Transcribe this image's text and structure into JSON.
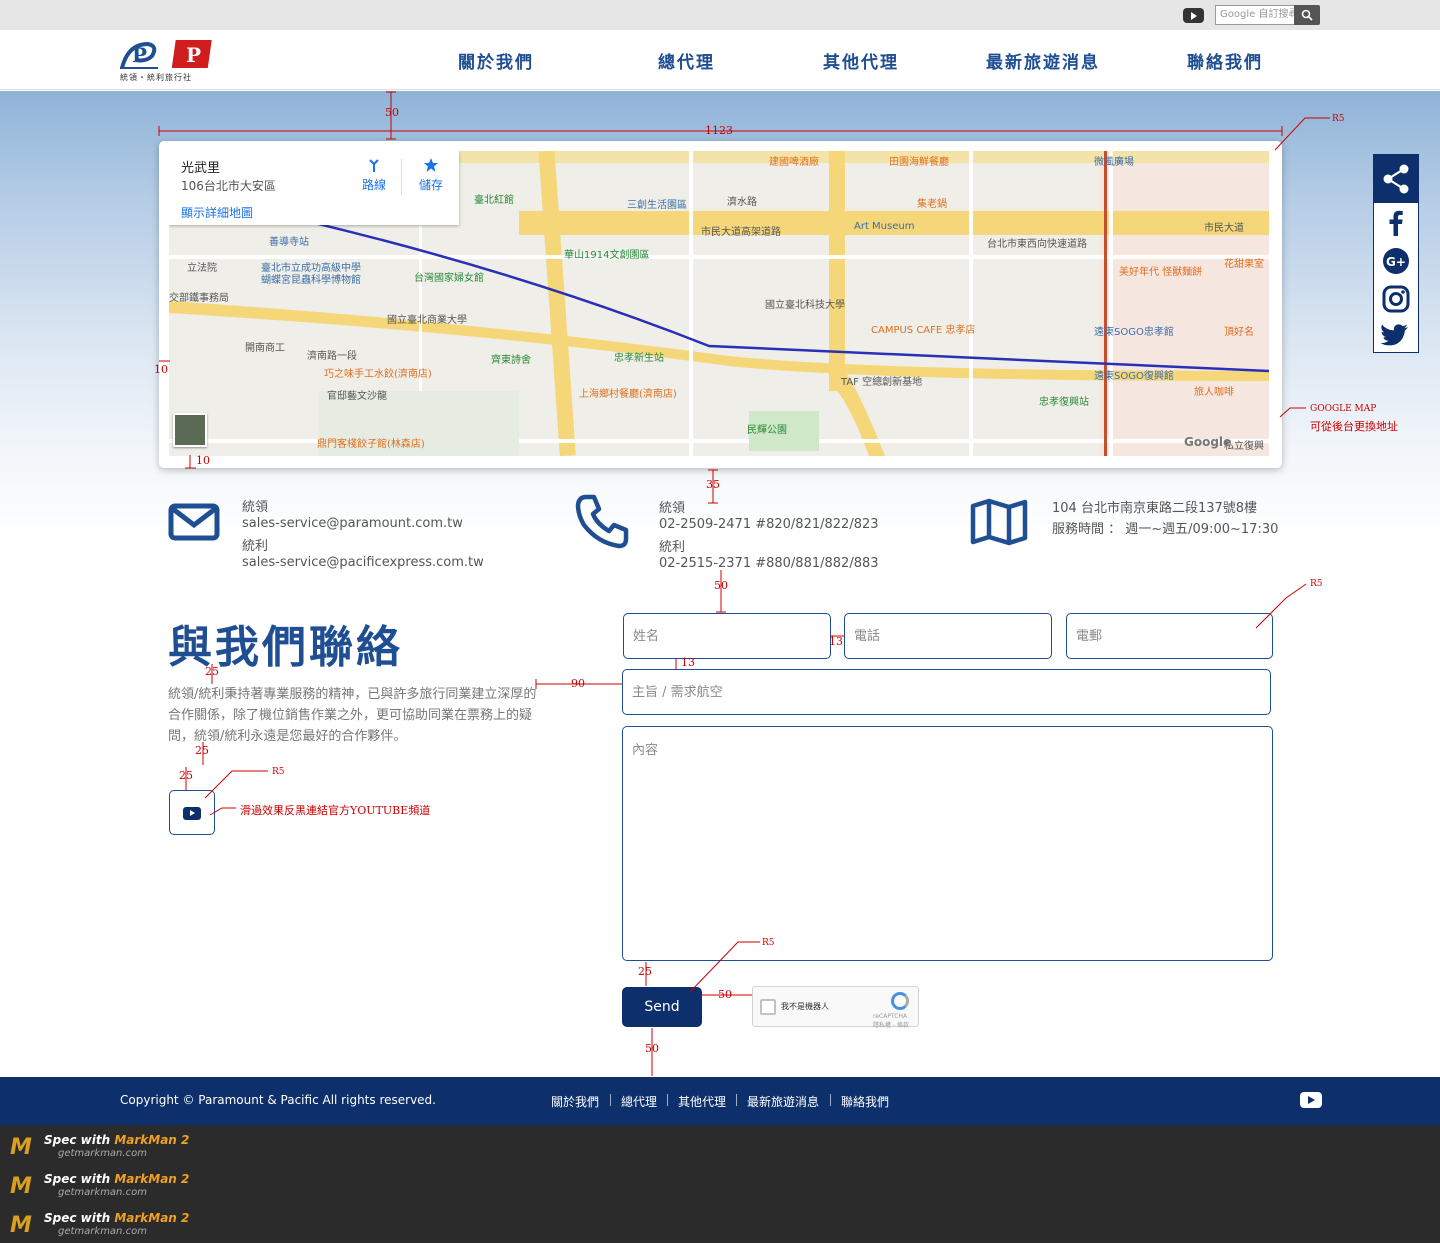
{
  "topbar": {
    "search_placeholder": "Google 自訂搜尋"
  },
  "header": {
    "logo_text": "統領・統利旅行社",
    "nav": [
      "關於我們",
      "總代理",
      "其他代理",
      "最新旅遊消息",
      "聯絡我們"
    ]
  },
  "map": {
    "place_name": "光武里",
    "address": "106台北市大安區",
    "detail_link": "顯示詳細地圖",
    "route_label": "路線",
    "save_label": "儲存",
    "google_mark": "Google",
    "labels": [
      "建國啤酒廠",
      "田園海鮮餐廳",
      "微風廣場",
      "臺北紅館",
      "濟水路",
      "三創生活園區",
      "市民大道高架道路",
      "Art Museum",
      "集老鍋",
      "市民大道",
      "善導寺站",
      "華山1914文創園區",
      "台北市東西向快速道路",
      "立法院",
      "臺北市立成功高級中學",
      "蝴蝶宮昆蟲科學博物館",
      "台灣國家婦女館",
      "美好年代 怪獸麵餅",
      "花甜果室",
      "交部鐵事務局",
      "國立臺北科技大學",
      "國立臺北商業大學",
      "CAMPUS CAFE 忠孝店",
      "遠東SOGO忠孝館",
      "頂好名",
      "開南商工",
      "濟南路一段",
      "齊東詩舍",
      "忠孝新生站",
      "巧之味手工水餃(濟南店)",
      "上海鄉村餐廳(濟南店)",
      "TAF 空總創新基地",
      "遠東SOGO復興館",
      "旅人咖啡",
      "官邸藝文沙龍",
      "忠孝復興站",
      "鼎門客棧餃子館(林森店)",
      "民輝公園",
      "私立復興"
    ]
  },
  "social": [
    "share-icon",
    "facebook-icon",
    "google-plus-icon",
    "instagram-icon",
    "twitter-icon"
  ],
  "contact_info": {
    "email": {
      "label1": "統領",
      "value1": "sales-service@paramount.com.tw",
      "label2": "統利",
      "value2": "sales-service@pacificexpress.com.tw"
    },
    "phone": {
      "label1": "統領",
      "value1": "02-2509-2471 #820/821/822/823",
      "label2": "統利",
      "value2": "02-2515-2371 #880/881/882/883"
    },
    "address": {
      "line1": "104 台北市南京東路二段137號8樓",
      "line2": "服務時間 ： 週一~週五/09:00~17:30"
    }
  },
  "contact_form": {
    "title": "與我們聯絡",
    "description": "統領/統利秉持著專業服務的精神，已與許多旅行同業建立深厚的合作關係，除了機位銷售作業之外，更可協助同業在票務上的疑問，統領/統利永遠是您最好的合作夥伴。",
    "name_placeholder": "姓名",
    "phone_placeholder": "電話",
    "email_placeholder": "電郵",
    "subject_placeholder": "主旨 / 需求航空",
    "content_placeholder": "內容",
    "send_label": "Send",
    "recaptcha_label": "我不是機器人",
    "recaptcha_brand": "reCAPTCHA",
    "recaptcha_terms": "隱私權 - 條款"
  },
  "footer": {
    "copyright": "Copyright ©  Paramount & Pacific  All rights reserved.",
    "links": [
      "關於我們",
      "總代理",
      "其他代理",
      "最新旅遊消息",
      "聯絡我們"
    ]
  },
  "markman": {
    "line1_a": "Spec with ",
    "line1_b": "MarkMan 2",
    "line2": "getmarkman.com"
  },
  "annotations": {
    "gap_top": "50",
    "map_width": "1123",
    "radius_map": "R5",
    "map_inner_pad_left": "10",
    "map_inner_pad_bottom": "10",
    "gmap_note_1": "GOOGLE MAP",
    "gmap_note_2": "可從後台更換地址",
    "gap_info": "35",
    "gap_form": "50",
    "radius_fields": "R5",
    "gap_fields_h": "13",
    "gap_fields_v": "13",
    "gap_title": "25",
    "gap_desc_form": "90",
    "gap_desc_yt": "25",
    "gap_yt_left": "25",
    "radius_yt": "R5",
    "yt_note": "滑過效果反黑連結官方YOUTUBE頻道",
    "radius_send": "R5",
    "gap_send_top": "25",
    "gap_send_captcha": "50",
    "gap_footer": "50"
  }
}
